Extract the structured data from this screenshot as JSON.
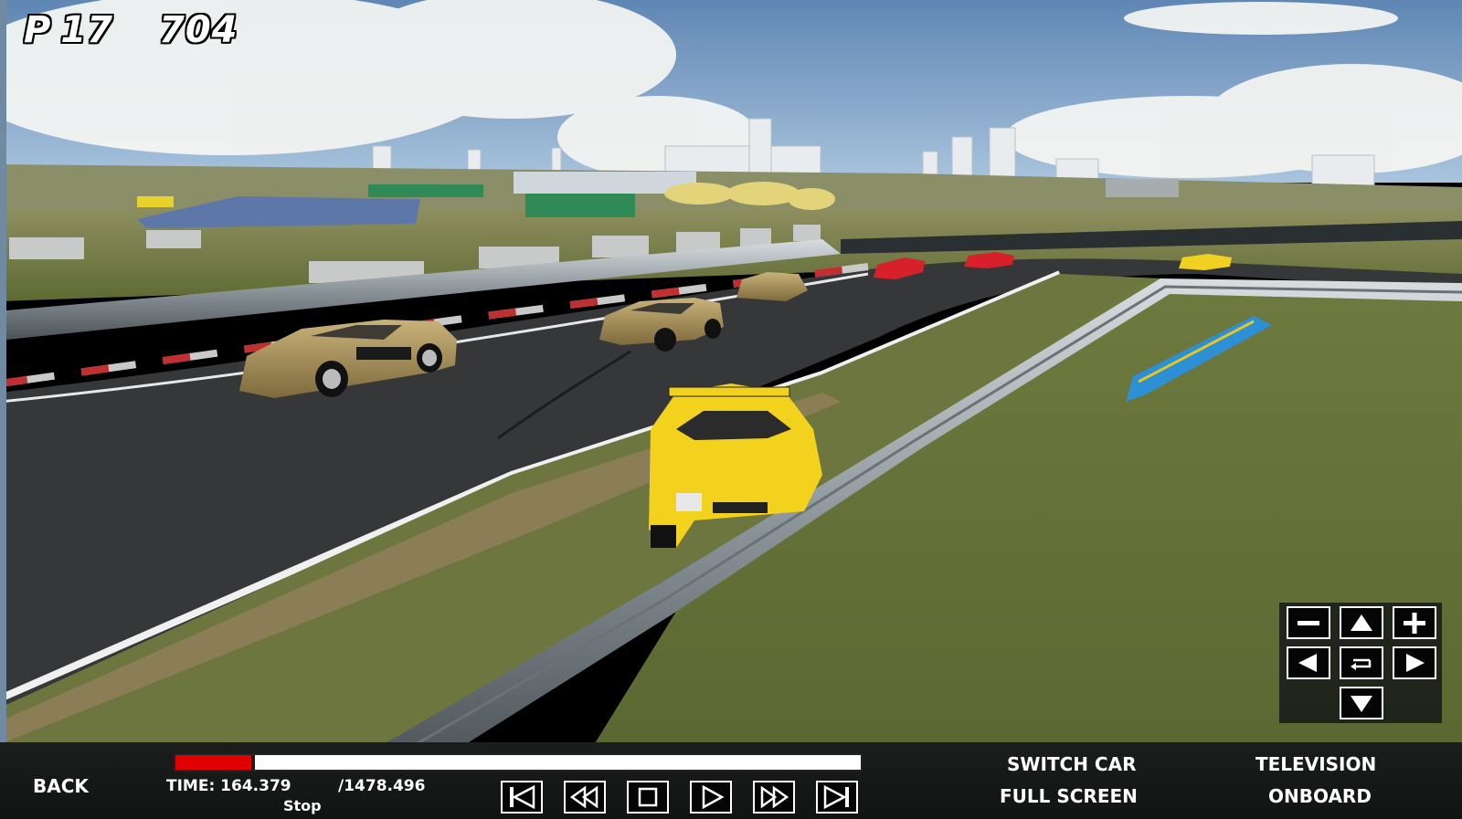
{
  "hud": {
    "position_prefix": "P",
    "position": "17",
    "score": "704"
  },
  "camera_pad": {
    "zoom_out": "minus-icon",
    "up": "arrow-up-icon",
    "zoom_in": "plus-icon",
    "left": "arrow-left-icon",
    "reset": "reset-icon",
    "right": "arrow-right-icon",
    "down": "arrow-down-icon"
  },
  "replay_bar": {
    "back_label": "BACK",
    "time_label": "TIME:",
    "time_value": "164.379",
    "total_time": "/1478.496",
    "state": "Stop",
    "progress": 0.111,
    "transport": [
      "skip-start-icon",
      "rewind-icon",
      "stop-icon",
      "play-icon",
      "fast-forward-icon",
      "skip-end-icon"
    ],
    "switch_car": "SWITCH CAR",
    "full_screen": "FULL SCREEN",
    "television": "TELEVISION",
    "onboard": "ONBOARD"
  },
  "colors": {
    "progress_fill": "#e00000",
    "sky": "#7fa7cf",
    "grass": "#6f7a3a",
    "track": "#353536"
  }
}
